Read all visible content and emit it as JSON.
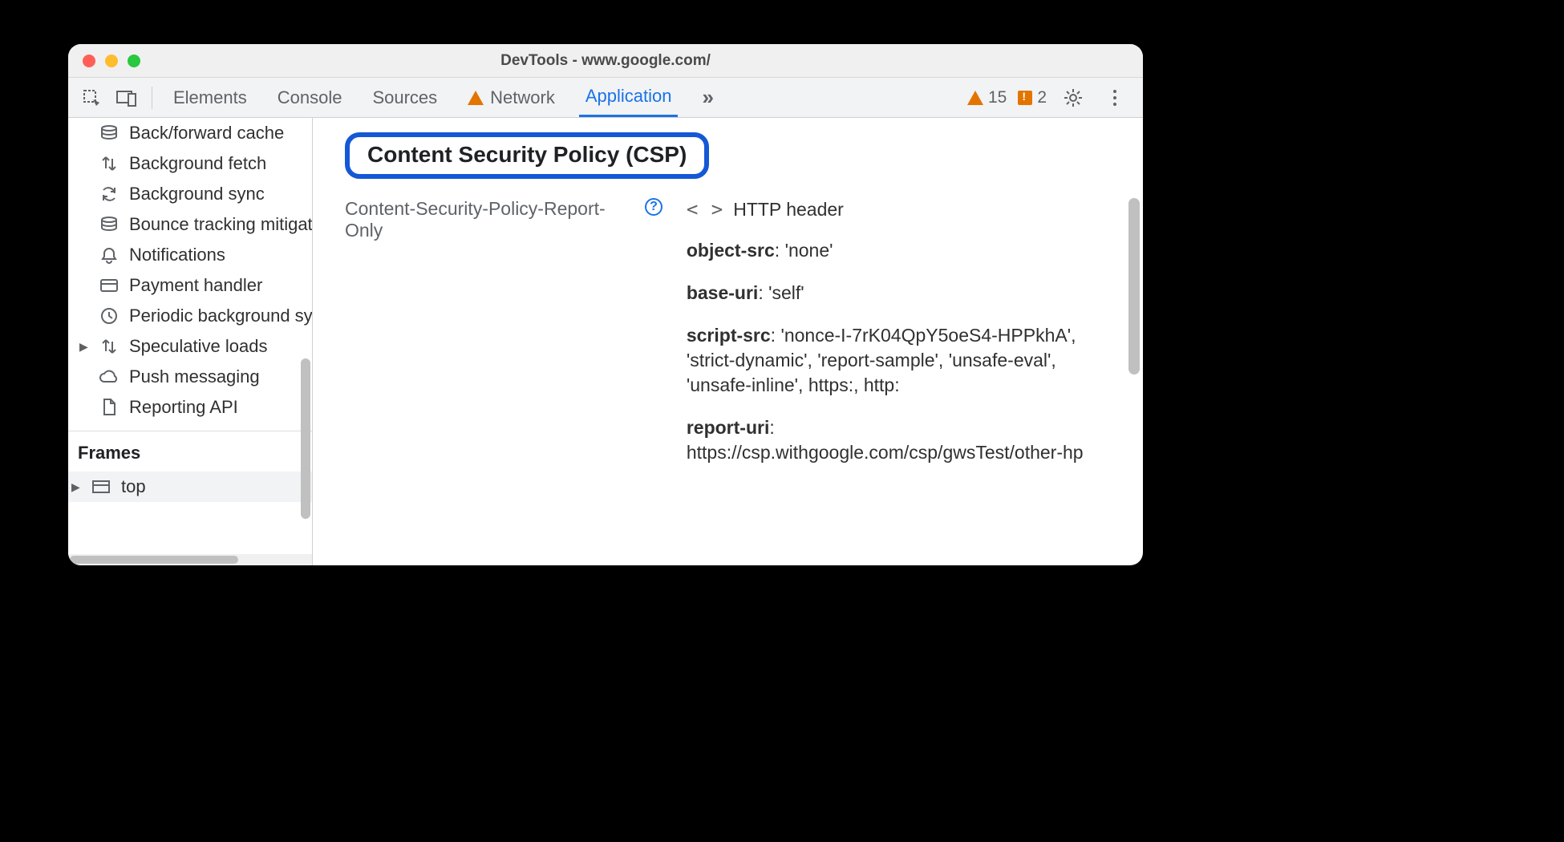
{
  "window": {
    "title": "DevTools - www.google.com/"
  },
  "tabs": {
    "items": [
      "Elements",
      "Console",
      "Sources",
      "Network",
      "Application"
    ],
    "active": "Application",
    "network_has_warning": true
  },
  "toolbar_right": {
    "warning_count": "15",
    "issue_count": "2"
  },
  "sidebar": {
    "items": [
      {
        "icon": "database-icon",
        "label": "Back/forward cache"
      },
      {
        "icon": "sync-arrows-icon",
        "label": "Background fetch"
      },
      {
        "icon": "refresh-icon",
        "label": "Background sync"
      },
      {
        "icon": "database-icon",
        "label": "Bounce tracking mitigation"
      },
      {
        "icon": "bell-icon",
        "label": "Notifications"
      },
      {
        "icon": "credit-card-icon",
        "label": "Payment handler"
      },
      {
        "icon": "clock-icon",
        "label": "Periodic background sync"
      },
      {
        "icon": "sync-arrows-icon",
        "label": "Speculative loads",
        "expandable": true
      },
      {
        "icon": "cloud-icon",
        "label": "Push messaging"
      },
      {
        "icon": "file-icon",
        "label": "Reporting API"
      }
    ],
    "frames_heading": "Frames",
    "frames": [
      {
        "icon": "window-icon",
        "label": "top",
        "expandable": true
      }
    ]
  },
  "main": {
    "csp_heading": "Content Security Policy (CSP)",
    "policy_name": "Content-Security-Policy-Report-Only",
    "source_label": "HTTP header",
    "directives": [
      {
        "name": "object-src",
        "value": "'none'"
      },
      {
        "name": "base-uri",
        "value": "'self'"
      },
      {
        "name": "script-src",
        "value": "'nonce-I-7rK04QpY5oeS4-HPPkhA', 'strict-dynamic', 'report-sample', 'unsafe-eval', 'unsafe-inline', https:, http:"
      },
      {
        "name": "report-uri",
        "value": "https://csp.withgoogle.com/csp/gwsTest/other-hp"
      }
    ]
  }
}
